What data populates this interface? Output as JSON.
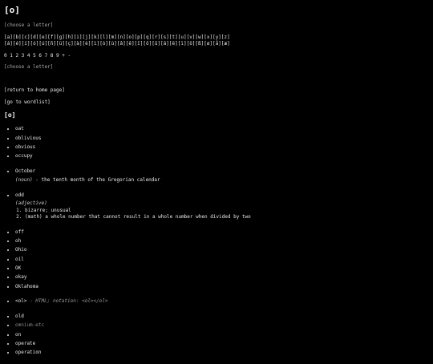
{
  "page_title": "[o]",
  "choose_letter_1": "[choose a letter]",
  "letters_row1": "[a][b][c][d][e][f][g][h][i][j][k][l][m][n][o][p][q][r][s][t][u][v][w][x][y][z]",
  "letters_row2": "[á][é][í][ó][ú][ñ][ü][ç][à][è][ì][ò][ù][â][ê][î][ô][û][ä][ë][ï][ö][ß][ø][å][æ]",
  "digits_row": "0 1 2 3 4 5 6 7 8 9 + -",
  "choose_letter_2": "[choose a letter]",
  "return_home": "[return to home page]",
  "go_wordlist": "[go to wordlist]",
  "section_title": "[o]",
  "group1": [
    "oat",
    "oblivious",
    "obvious",
    "occupy"
  ],
  "october": {
    "word": "October",
    "pos": "(noun)",
    "definition": " - the tenth month of the Gregorian calendar"
  },
  "odd": {
    "word": "odd",
    "pos": "(adjective)",
    "senses": [
      "bizarre; unusual",
      "(math) a whole number that cannot result in a whole number when divided by two"
    ]
  },
  "group2": [
    "off",
    "oh",
    "Ohio",
    "oil",
    "OK",
    "okay",
    "Oklahoma"
  ],
  "ol": {
    "word": "<ol>",
    "note": " - HTML; notation: <ol></ol>"
  },
  "group3": [
    "old",
    "omnium-etc",
    "on",
    "operate",
    "operation"
  ]
}
